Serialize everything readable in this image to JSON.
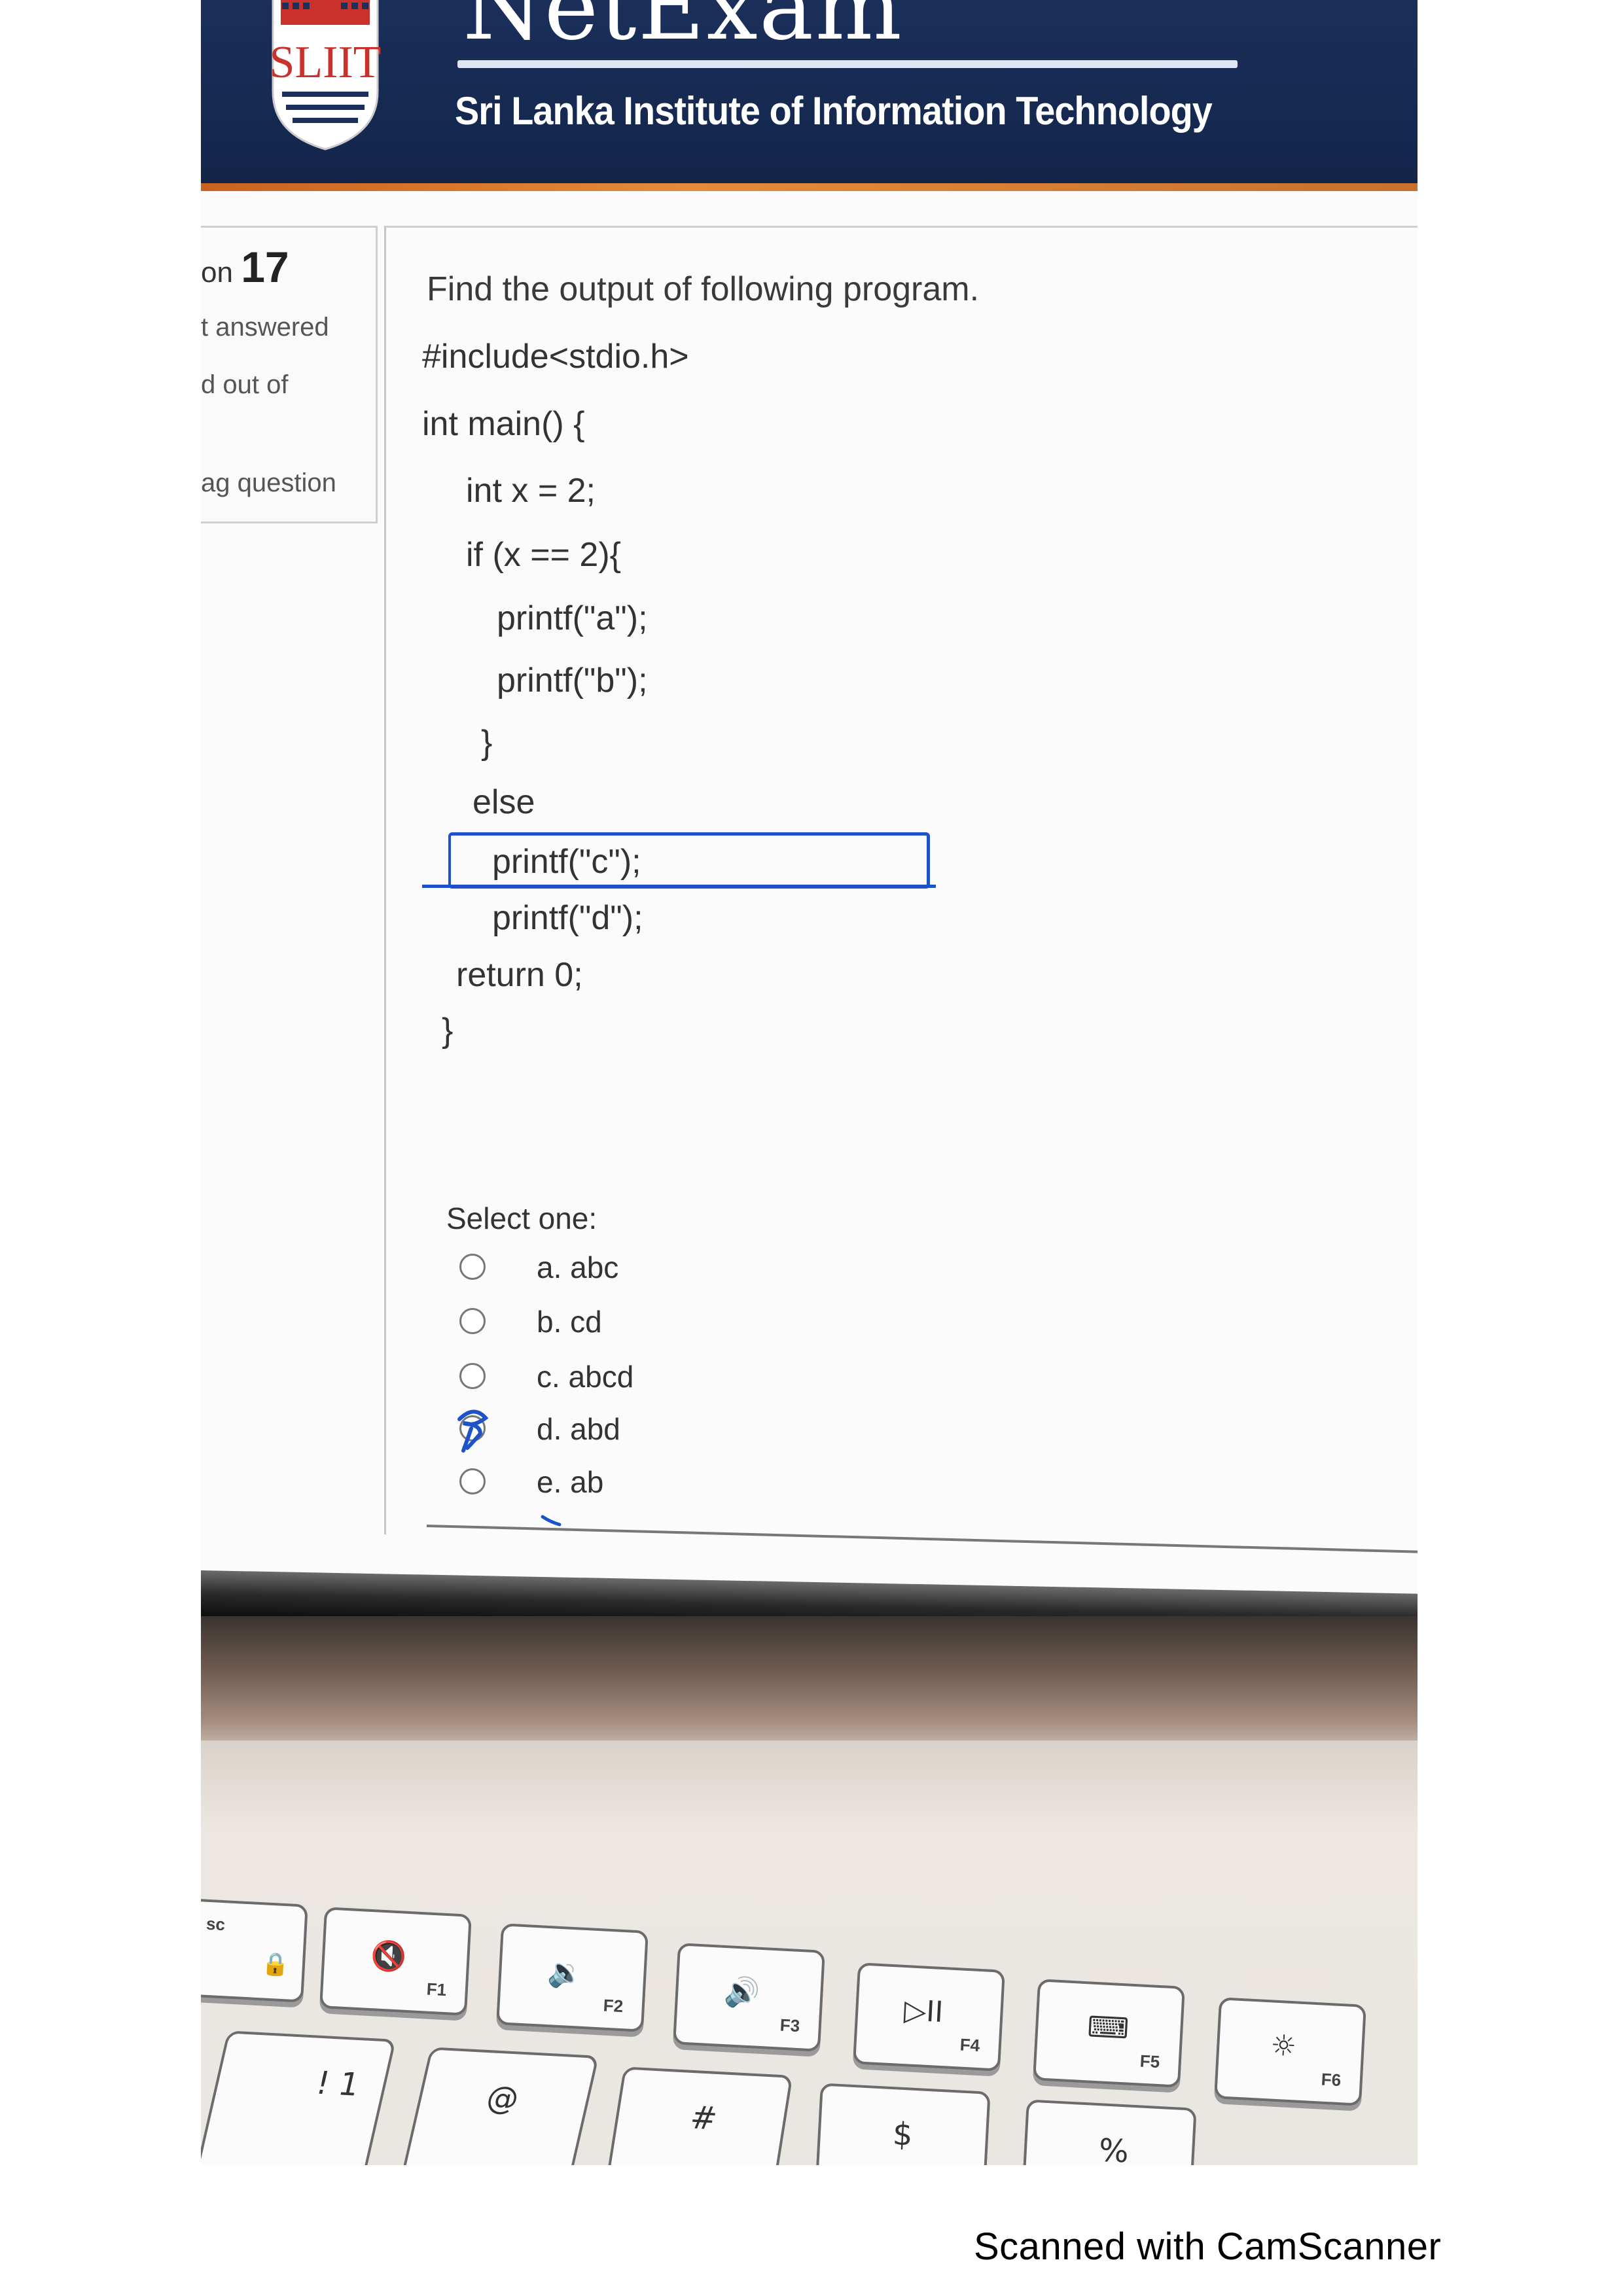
{
  "header": {
    "site_name": "NetExam",
    "institute": "Sri Lanka Institute of Information Technology",
    "logo_text": "SLIIT"
  },
  "info_panel": {
    "question_prefix": "on",
    "question_number": "17",
    "status": "t answered",
    "marked": "d out of",
    "flag": "ag question"
  },
  "question": {
    "prompt": "Find the output of following program.",
    "code_lines": [
      "#include<stdio.h>",
      "int main() {",
      "int x = 2;",
      "if (x == 2){",
      "printf(\"a\");",
      "printf(\"b\");",
      "}",
      "else",
      "printf(\"c\");",
      "printf(\"d\");",
      "return 0;",
      "}"
    ],
    "select_label": "Select one:",
    "options": [
      {
        "label": "a. abc",
        "checked": false
      },
      {
        "label": "b. cd",
        "checked": false
      },
      {
        "label": "c. abcd",
        "checked": false
      },
      {
        "label": "d. abd",
        "checked": true
      },
      {
        "label": "e. ab",
        "checked": false
      }
    ]
  },
  "keyboard": {
    "keys": [
      {
        "glyph": "🔒",
        "sub": "sc"
      },
      {
        "glyph": "🔇",
        "sub": "F1"
      },
      {
        "glyph": "🔉",
        "sub": "F2"
      },
      {
        "glyph": "🔊",
        "sub": "F3"
      },
      {
        "glyph": "▷II",
        "sub": "F4"
      },
      {
        "glyph": "⌨",
        "sub": "F5"
      },
      {
        "glyph": "☼",
        "sub": "F6"
      }
    ],
    "number_row": [
      "! 1",
      "@",
      "#",
      "$",
      "%"
    ]
  },
  "watermark": "Scanned with CamScanner",
  "colors": {
    "banner": "#15284f",
    "annotation": "#1e52c9"
  }
}
